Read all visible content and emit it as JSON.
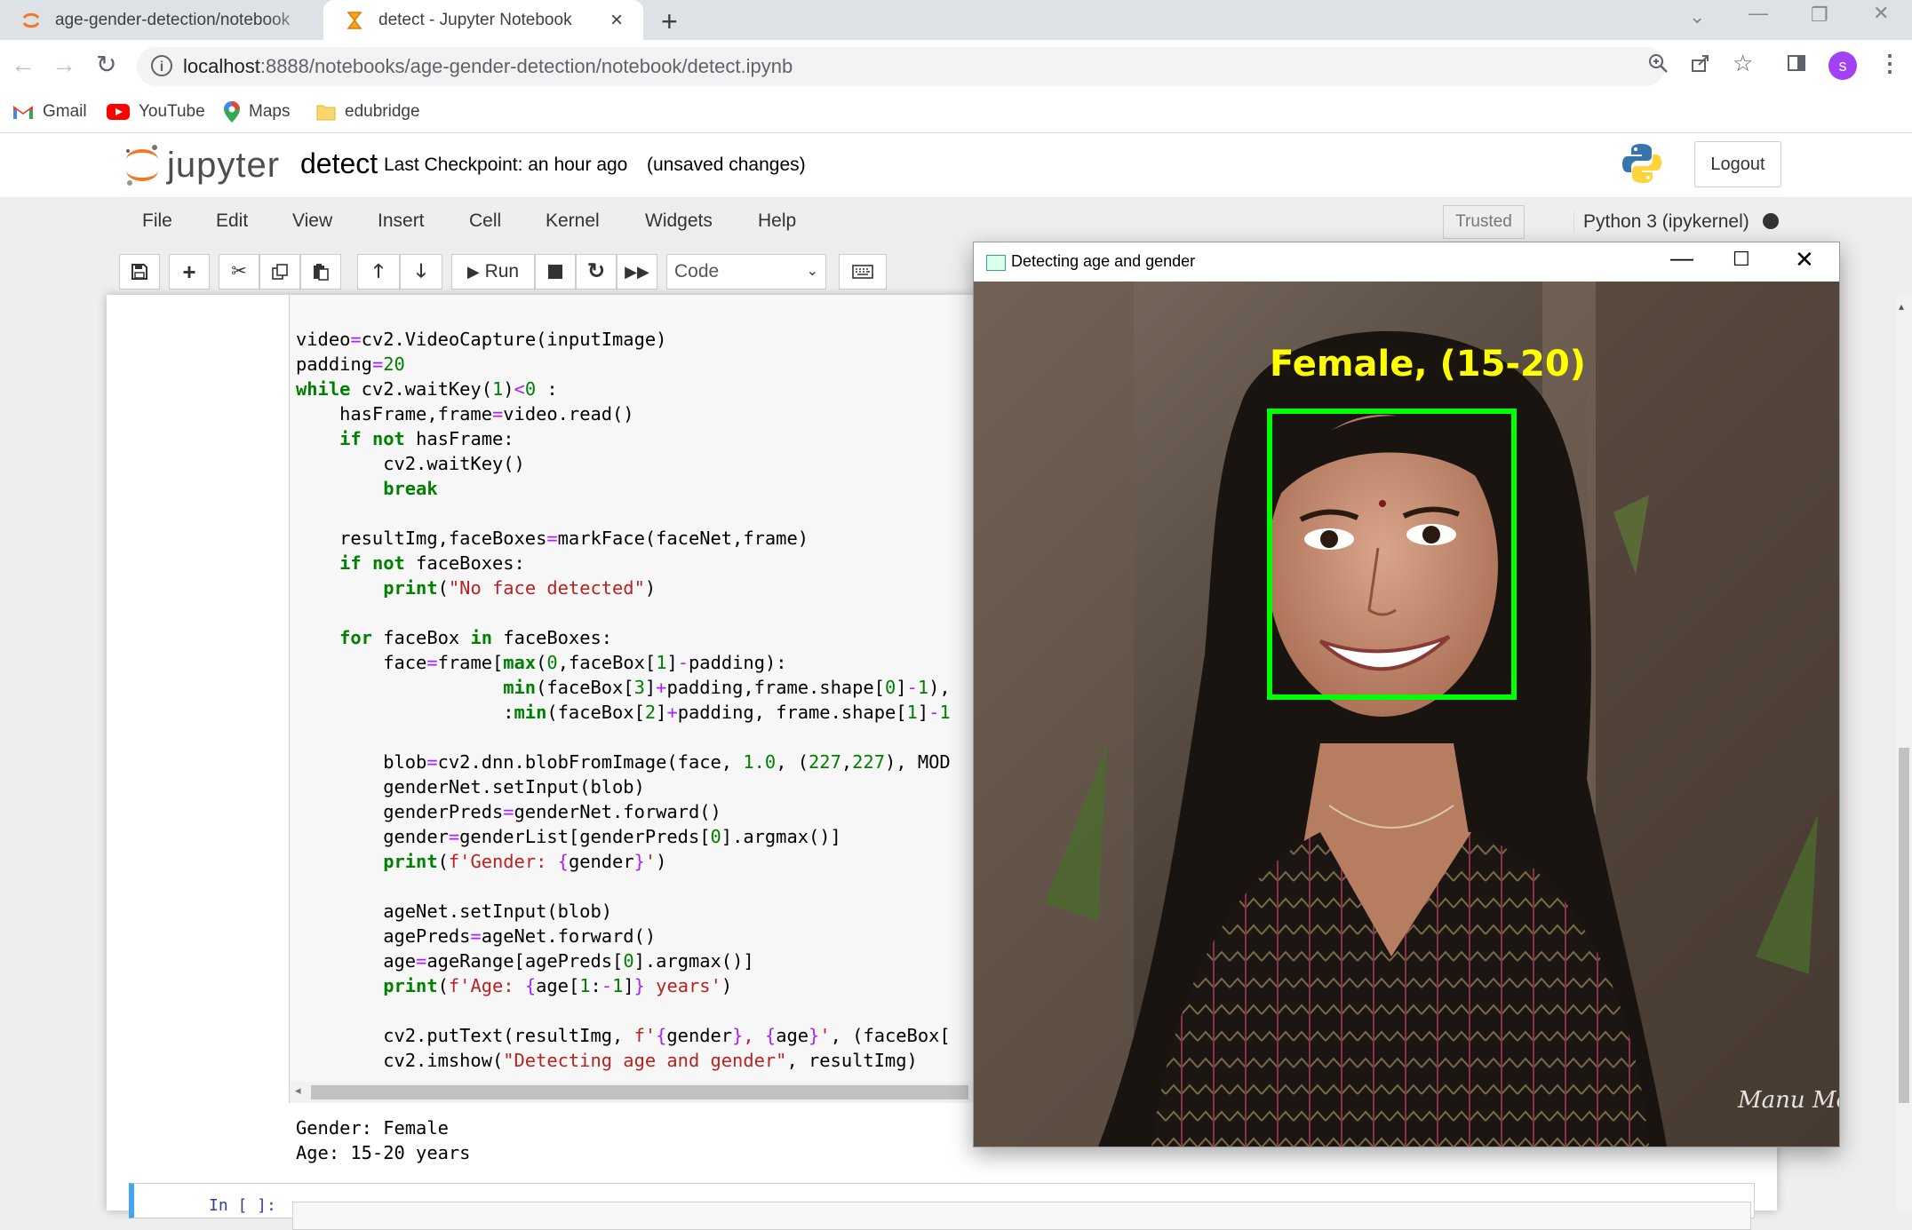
{
  "browser": {
    "tabs": [
      {
        "title": "age-gender-detection/notebook",
        "active": false
      },
      {
        "title": "detect - Jupyter Notebook",
        "active": true
      }
    ],
    "url_host": "localhost",
    "url_path": ":8888/notebooks/age-gender-detection/notebook/detect.ipynb",
    "avatar_letter": "s",
    "bookmarks": [
      "Gmail",
      "YouTube",
      "Maps",
      "edubridge"
    ]
  },
  "jupyter": {
    "logo_text": "jupyter",
    "notebook_name": "detect",
    "checkpoint": "Last Checkpoint: an hour ago",
    "unsaved": "(unsaved changes)",
    "logout": "Logout",
    "menu": [
      "File",
      "Edit",
      "View",
      "Insert",
      "Cell",
      "Kernel",
      "Widgets",
      "Help"
    ],
    "trusted": "Trusted",
    "kernel": "Python 3 (ipykernel)",
    "run_label": "Run",
    "cell_type": "Code",
    "next_prompt": "In [ ]:"
  },
  "output_lines": [
    "Gender: Female",
    "Age: 15-20 years"
  ],
  "cv_window": {
    "title": "Detecting age and gender",
    "label": "Female, (15-20)",
    "watermark": "Manu Mohan",
    "colors": {
      "box": "#00ff00",
      "label": "#ffff00"
    }
  },
  "colors": {
    "accent": "#f37726",
    "cell_border": "#42a5f5"
  }
}
